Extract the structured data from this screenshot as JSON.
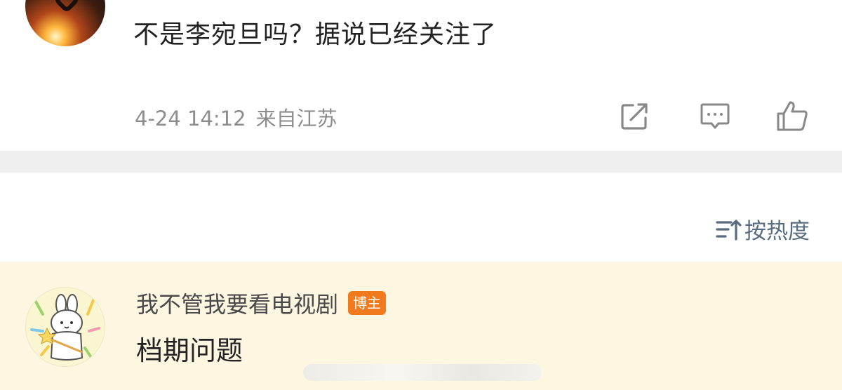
{
  "post": {
    "text": "不是李宛旦吗？据说已经关注了",
    "date": "4-24 14:12",
    "location": "来自江苏"
  },
  "sort": {
    "label": "按热度",
    "icon": "sort-icon"
  },
  "comment": {
    "username": "我不管我要看电视剧",
    "badge": "博主",
    "text": "档期问题"
  },
  "icons": [
    "share-icon",
    "comment-icon",
    "like-icon"
  ],
  "colors": {
    "separator": "#efefef",
    "comment_bg": "#fdf7e2",
    "badge_bg": "#f07a1d",
    "sort_text": "#596b80",
    "meta_text": "#8d8d8d"
  }
}
